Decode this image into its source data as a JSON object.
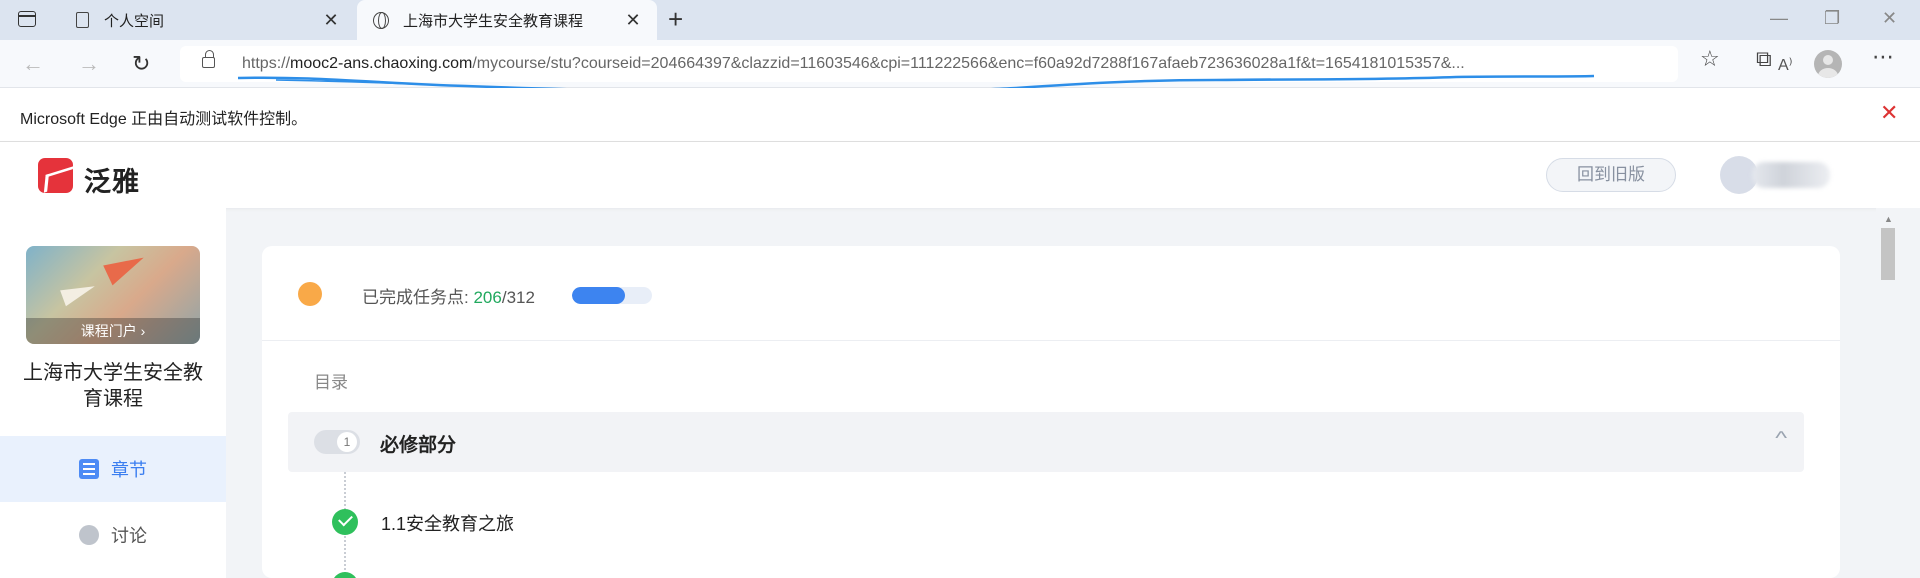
{
  "browser": {
    "tabs": [
      {
        "label": "个人空间",
        "active": false
      },
      {
        "label": "上海市大学生安全教育课程",
        "active": true
      }
    ],
    "url": {
      "protocol": "https://",
      "host": "mooc2-ans.chaoxing.com",
      "path": "/mycourse/stu?courseid=204664397&clazzid=11603546&cpi=111222566&enc=f60a92d7288f167afaeb723636028a1f&t=1654181015357&..."
    },
    "infobar_text": "Microsoft Edge 正由自动测试软件控制。"
  },
  "site": {
    "logo_text": "泛雅",
    "old_version_label": "回到旧版"
  },
  "sidebar": {
    "cover_portal_label": "课程门户 ›",
    "course_title": "上海市大学生安全教育课程",
    "items": [
      {
        "label": "章节",
        "active": true
      },
      {
        "label": "讨论",
        "active": false
      }
    ]
  },
  "progress": {
    "label": "已完成任务点:",
    "done": "206",
    "total": "/312",
    "fraction": 0.66
  },
  "toc": {
    "label": "目录",
    "section_num": "1",
    "section_title": "必修部分",
    "chapters": [
      {
        "title": "1.1安全教育之旅",
        "status": "done"
      }
    ]
  },
  "colors": {
    "accent": "#3d84f0",
    "done_green": "#2fc05c",
    "status_orange": "#f9a948",
    "brand_red": "#e5333b"
  }
}
